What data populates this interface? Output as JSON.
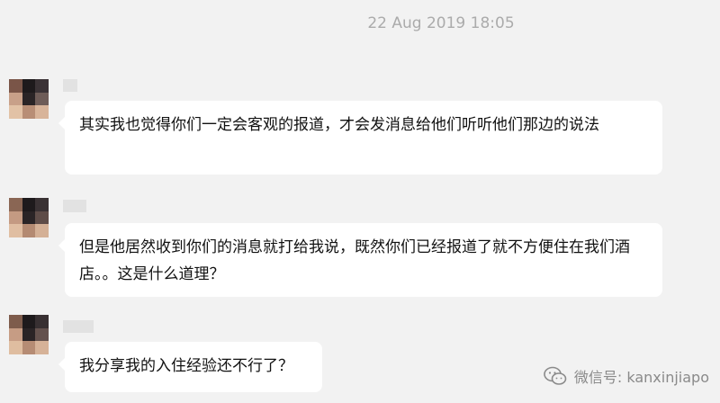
{
  "chat": {
    "timestamp": "22 Aug 2019 18:05",
    "messages": [
      {
        "text": "其实我也觉得你们一定会客观的报道，才会发消息给他们听听他们那边的说法"
      },
      {
        "text": "但是他居然收到你们的消息就打给我说，既然你们已经报道了就不方便住在我们酒店。。这是什么道理？"
      },
      {
        "text": "我分享我的入住经验还不行了？"
      }
    ]
  },
  "watermark": {
    "icon": "wechat-icon",
    "text": "微信号: kanxinjiapo"
  },
  "colors": {
    "background": "#f2f2f2",
    "bubble": "#ffffff",
    "timestamp": "#ababab",
    "message_text": "#111111"
  }
}
